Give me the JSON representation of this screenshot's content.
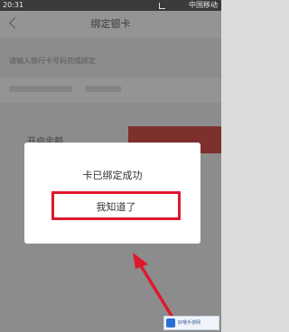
{
  "statusbar": {
    "time": "20:31",
    "carrier": "中国移动"
  },
  "header": {
    "title": "绑定银卡"
  },
  "form": {
    "hint": "请输入银行卡号码完成绑定"
  },
  "background": {
    "label": "开启余额",
    "button_label": ""
  },
  "dialog": {
    "message": "卡已绑定成功",
    "confirm_label": "我知道了"
  },
  "watermark": {
    "text": "好哦手游网"
  },
  "colors": {
    "accent": "#e0182c",
    "background_button": "#d9534f"
  }
}
